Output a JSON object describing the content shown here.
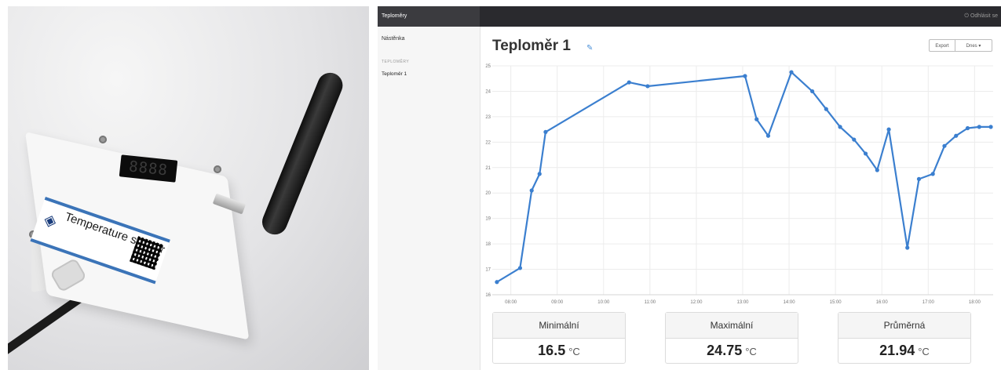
{
  "photo": {
    "sticker_title": "Temperature sensor",
    "display_text": "8888"
  },
  "app": {
    "brand": "Teploměry",
    "logout_label": "Odhlásit se",
    "sidebar": {
      "dashboard": "Nástěnka",
      "section_title": "TEPLOMĚRY",
      "items": [
        "Teploměr 1"
      ]
    },
    "page_title": "Teploměr 1",
    "export_label": "Export",
    "range_label": "Dnes ▾",
    "stats": [
      {
        "label": "Minimální",
        "value": "16.5",
        "unit": "°C"
      },
      {
        "label": "Maximální",
        "value": "24.75",
        "unit": "°C"
      },
      {
        "label": "Průměrná",
        "value": "21.94",
        "unit": "°C"
      }
    ]
  },
  "chart_data": {
    "type": "line",
    "color": "#3b7fcf",
    "xticks": [
      "08:00",
      "09:00",
      "10:00",
      "11:00",
      "12:00",
      "13:00",
      "14:00",
      "15:00",
      "16:00",
      "17:00",
      "18:00"
    ],
    "xlim": [
      7.6,
      18.4
    ],
    "ylim": [
      16,
      25
    ],
    "yticks": [
      16,
      17,
      18,
      19,
      20,
      21,
      22,
      23,
      24,
      25
    ],
    "grid": true,
    "points": [
      [
        7.7,
        16.5
      ],
      [
        8.2,
        17.05
      ],
      [
        8.45,
        20.1
      ],
      [
        8.62,
        20.75
      ],
      [
        8.75,
        22.4
      ],
      [
        10.55,
        24.35
      ],
      [
        10.95,
        24.2
      ],
      [
        13.05,
        24.6
      ],
      [
        13.3,
        22.9
      ],
      [
        13.55,
        22.25
      ],
      [
        14.05,
        24.75
      ],
      [
        14.5,
        24.0
      ],
      [
        14.8,
        23.3
      ],
      [
        15.1,
        22.6
      ],
      [
        15.4,
        22.1
      ],
      [
        15.65,
        21.55
      ],
      [
        15.9,
        20.9
      ],
      [
        16.15,
        22.5
      ],
      [
        16.55,
        17.85
      ],
      [
        16.8,
        20.55
      ],
      [
        17.1,
        20.75
      ],
      [
        17.35,
        21.85
      ],
      [
        17.6,
        22.25
      ],
      [
        17.85,
        22.55
      ],
      [
        18.1,
        22.6
      ],
      [
        18.35,
        22.6
      ]
    ]
  }
}
